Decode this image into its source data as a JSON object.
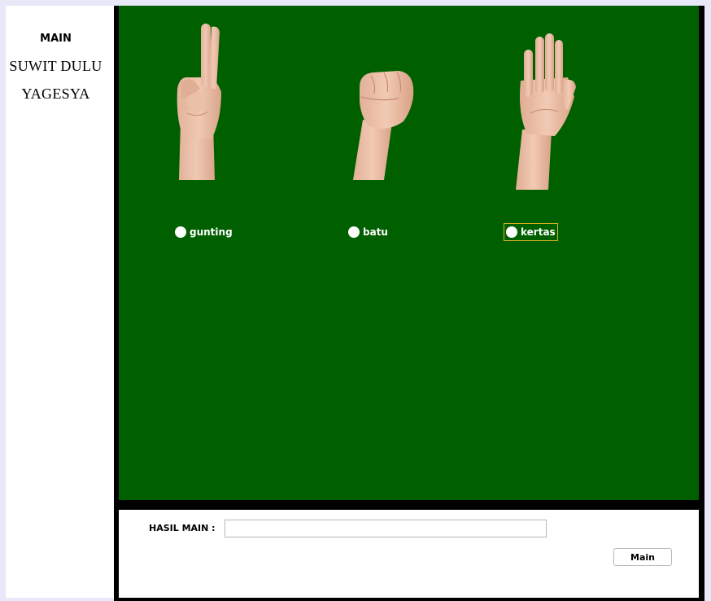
{
  "sidebar": {
    "menu_label": "MAIN",
    "title_line1": "SUWIT DULU",
    "title_line2": "YAGESYA"
  },
  "options": [
    {
      "label": "gunting",
      "icon": "scissors-hand-icon",
      "selected": false
    },
    {
      "label": "batu",
      "icon": "rock-fist-icon",
      "selected": false
    },
    {
      "label": "kertas",
      "icon": "paper-palm-icon",
      "selected": false,
      "focused": true
    }
  ],
  "result": {
    "label": "HASIL MAIN :",
    "value": ""
  },
  "actions": {
    "play_label": "Main"
  },
  "colors": {
    "game_bg": "#006000",
    "frame": "#000000",
    "focus": "#e0b020"
  }
}
